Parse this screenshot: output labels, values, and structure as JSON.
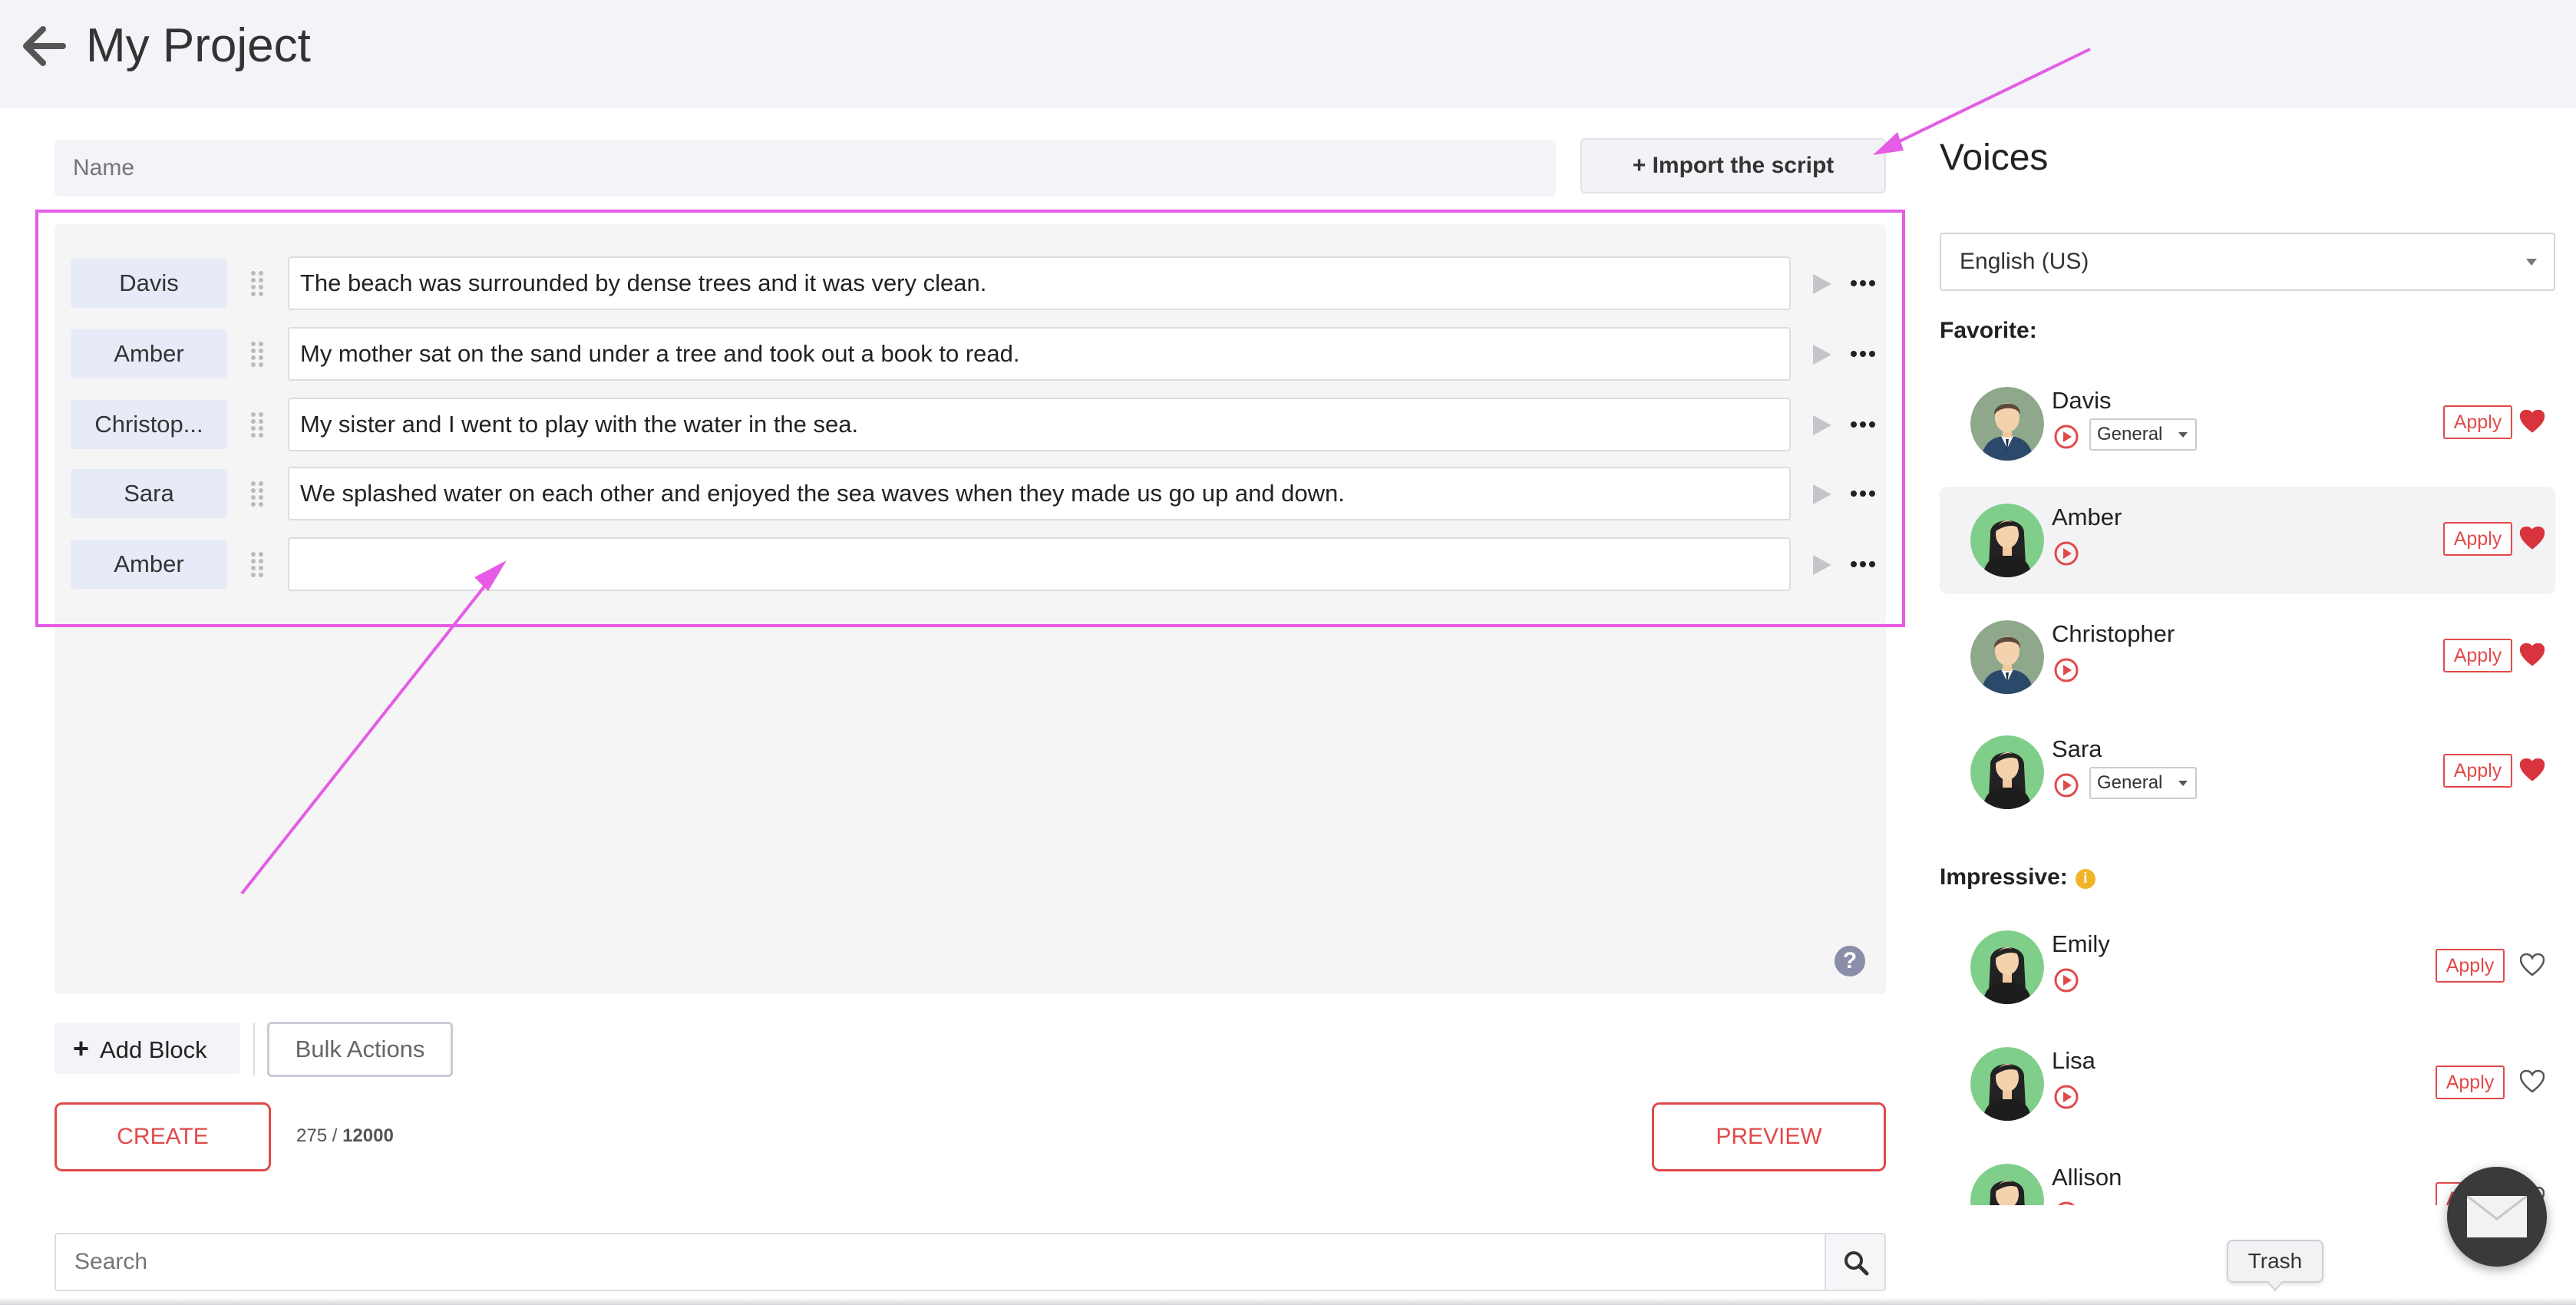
{
  "header": {
    "title": "My Project"
  },
  "form": {
    "name_placeholder": "Name",
    "import_label": "+ Import the script"
  },
  "blocks": [
    {
      "speaker": "Davis",
      "text": "The beach was surrounded by dense trees and it was very clean."
    },
    {
      "speaker": "Amber",
      "text": "My mother sat on the sand under a tree and took out a book to read."
    },
    {
      "speaker": "Christop...",
      "text": "My sister and I went to play with the water in the sea."
    },
    {
      "speaker": "Sara",
      "text": "We splashed water on each other and enjoyed the sea waves when they made us go up and down."
    },
    {
      "speaker": "Amber",
      "text": ""
    }
  ],
  "help_icon": "?",
  "toolbar": {
    "add_block": "Add Block",
    "add_icon": "+",
    "bulk_actions": "Bulk Actions"
  },
  "actions": {
    "create": "CREATE",
    "preview": "PREVIEW",
    "count_used": "275",
    "count_sep": " / ",
    "count_max": "12000"
  },
  "search": {
    "placeholder": "Search"
  },
  "voices": {
    "title": "Voices",
    "language": "English (US)",
    "favorite_label": "Favorite:",
    "impressive_label": "Impressive:",
    "apply_label": "Apply",
    "style_label": "General",
    "info_icon": "i",
    "favorites": [
      {
        "name": "Davis",
        "gender": "male",
        "style": true,
        "selected": false
      },
      {
        "name": "Amber",
        "gender": "female",
        "style": false,
        "selected": true
      },
      {
        "name": "Christopher",
        "gender": "male",
        "style": false,
        "selected": false
      },
      {
        "name": "Sara",
        "gender": "female",
        "style": true,
        "selected": false
      }
    ],
    "impressive": [
      {
        "name": "Emily",
        "gender": "female"
      },
      {
        "name": "Lisa",
        "gender": "female"
      },
      {
        "name": "Allison",
        "gender": "female"
      }
    ]
  },
  "tooltip": {
    "trash": "Trash"
  },
  "colors": {
    "accent_red": "#e14a4a",
    "annotation": "#e65ce6",
    "speaker_bg": "#e6ebf7"
  }
}
